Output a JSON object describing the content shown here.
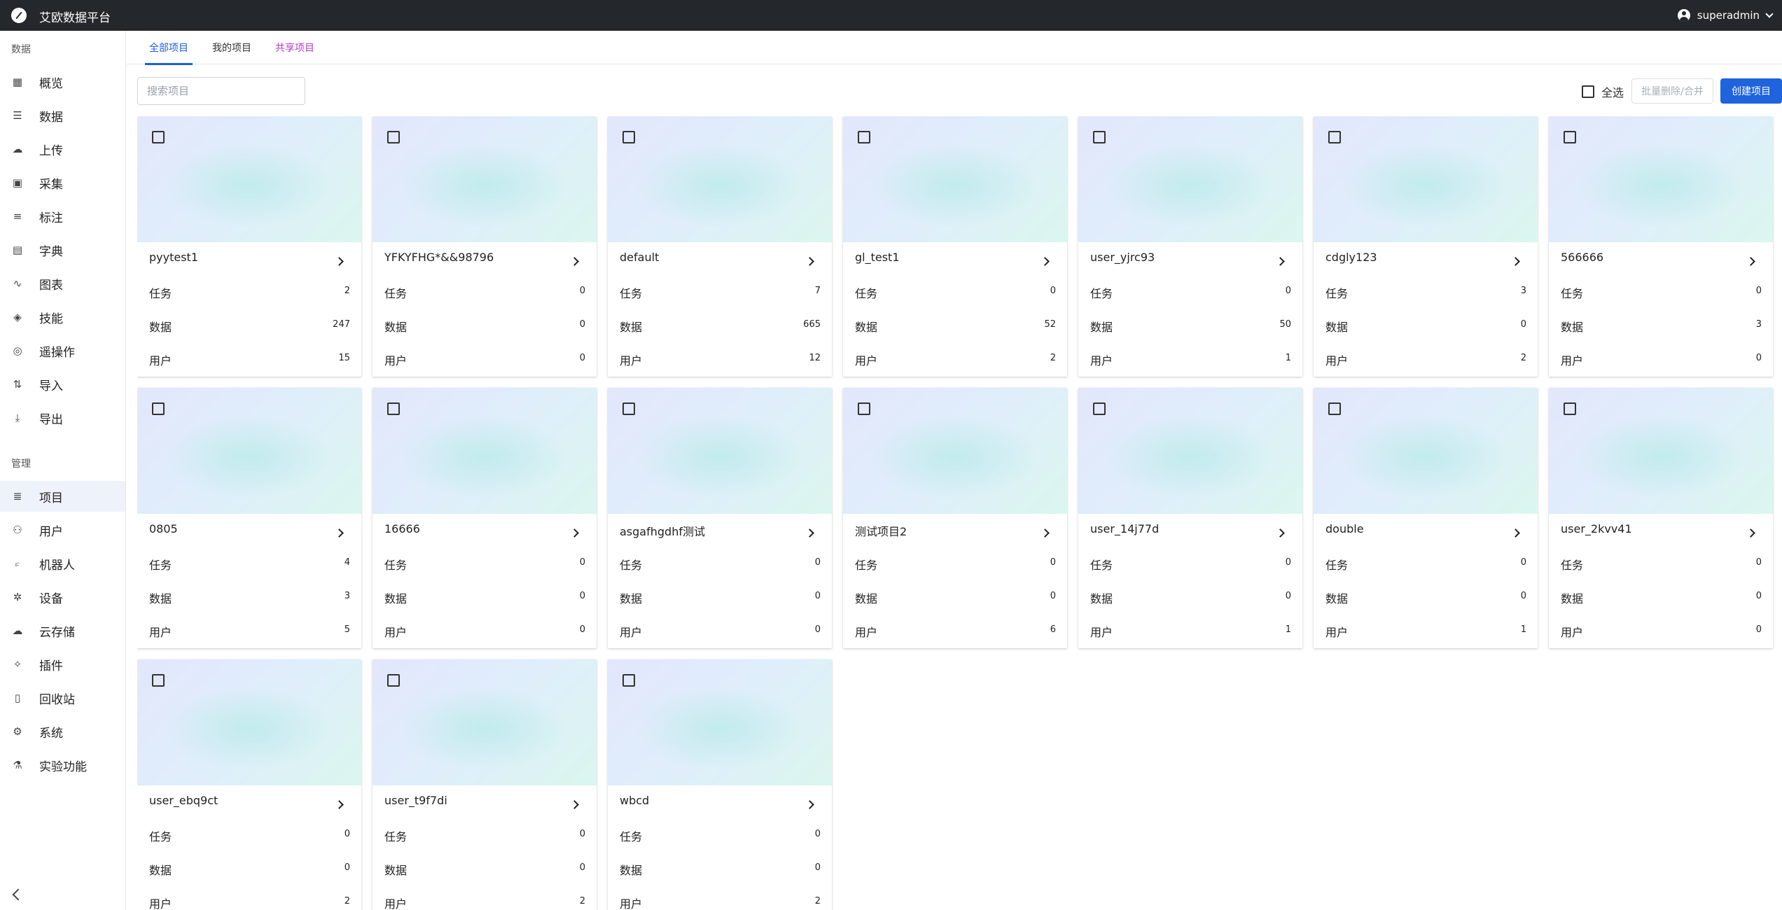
{
  "app": {
    "title": "艾欧数据平台",
    "user": "superadmin"
  },
  "sidebar": {
    "section_data": "数据",
    "section_manage": "管理",
    "data_items": [
      {
        "label": "概览",
        "icon": "dashboard-icon"
      },
      {
        "label": "数据",
        "icon": "list-icon"
      },
      {
        "label": "上传",
        "icon": "cloud-upload-icon"
      },
      {
        "label": "采集",
        "icon": "camera-icon"
      },
      {
        "label": "标注",
        "icon": "label-list-icon"
      },
      {
        "label": "字典",
        "icon": "book-icon"
      },
      {
        "label": "图表",
        "icon": "chart-icon"
      },
      {
        "label": "技能",
        "icon": "skill-icon"
      },
      {
        "label": "遥操作",
        "icon": "gamepad-icon"
      },
      {
        "label": "导入",
        "icon": "import-icon"
      },
      {
        "label": "导出",
        "icon": "download-icon"
      }
    ],
    "manage_items": [
      {
        "label": "项目",
        "icon": "project-icon",
        "active": true
      },
      {
        "label": "用户",
        "icon": "users-icon"
      },
      {
        "label": "机器人",
        "icon": "robot-arm-icon"
      },
      {
        "label": "设备",
        "icon": "device-icon"
      },
      {
        "label": "云存储",
        "icon": "cloud-icon"
      },
      {
        "label": "插件",
        "icon": "plugin-icon"
      },
      {
        "label": "回收站",
        "icon": "trash-icon"
      },
      {
        "label": "系统",
        "icon": "gear-icon"
      },
      {
        "label": "实验功能",
        "icon": "flask-icon"
      }
    ]
  },
  "tabs": [
    {
      "label": "全部项目",
      "active": true
    },
    {
      "label": "我的项目"
    },
    {
      "label": "共享项目"
    }
  ],
  "toolbar": {
    "search_placeholder": "搜索项目",
    "select_all": "全选",
    "batch_label": "批量删除/合并",
    "create_label": "创建项目"
  },
  "stat_labels": {
    "tasks": "任务",
    "data": "数据",
    "users": "用户"
  },
  "projects": [
    {
      "name": "pyytest1",
      "tasks": "2",
      "data": "247",
      "users": "15"
    },
    {
      "name": "YFKYFHG*&&98796",
      "tasks": "0",
      "data": "0",
      "users": "0"
    },
    {
      "name": "default",
      "tasks": "7",
      "data": "665",
      "users": "12"
    },
    {
      "name": "gl_test1",
      "tasks": "0",
      "data": "52",
      "users": "2"
    },
    {
      "name": "user_yjrc93",
      "tasks": "0",
      "data": "50",
      "users": "1"
    },
    {
      "name": "cdgly123",
      "tasks": "3",
      "data": "0",
      "users": "2"
    },
    {
      "name": "566666",
      "tasks": "0",
      "data": "3",
      "users": "0"
    },
    {
      "name": "0805",
      "tasks": "4",
      "data": "3",
      "users": "5"
    },
    {
      "name": "16666",
      "tasks": "0",
      "data": "0",
      "users": "0"
    },
    {
      "name": "asgafhgdhf测试",
      "tasks": "0",
      "data": "0",
      "users": "0"
    },
    {
      "name": "测试项目2",
      "tasks": "0",
      "data": "0",
      "users": "6"
    },
    {
      "name": "user_14j77d",
      "tasks": "0",
      "data": "0",
      "users": "1"
    },
    {
      "name": "double",
      "tasks": "0",
      "data": "0",
      "users": "1"
    },
    {
      "name": "user_2kvv41",
      "tasks": "0",
      "data": "0",
      "users": "0"
    },
    {
      "name": "user_ebq9ct",
      "tasks": "0",
      "data": "0",
      "users": "2"
    },
    {
      "name": "user_t9f7di",
      "tasks": "0",
      "data": "0",
      "users": "2"
    },
    {
      "name": "wbcd",
      "tasks": "0",
      "data": "0",
      "users": "2"
    }
  ]
}
